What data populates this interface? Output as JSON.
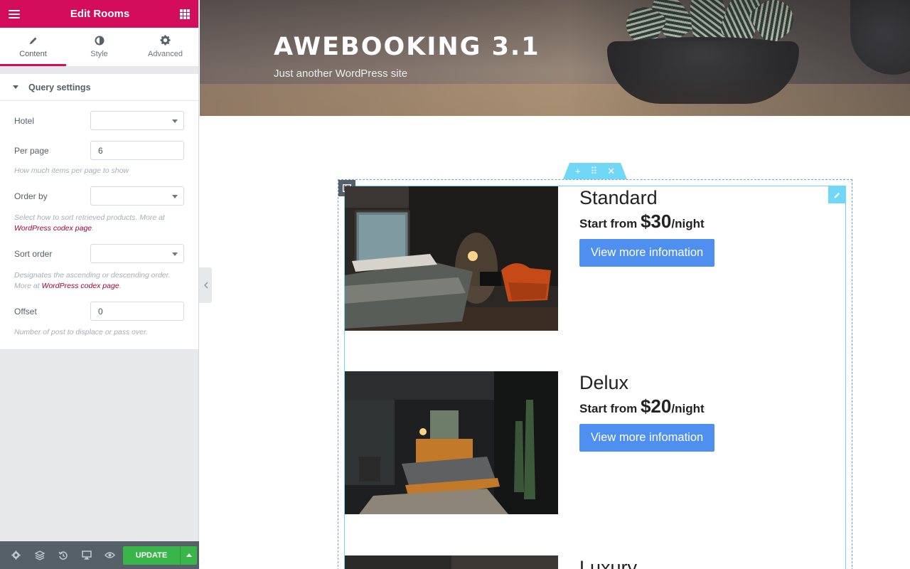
{
  "panel": {
    "title": "Edit Rooms",
    "tabs": [
      {
        "label": "Content",
        "icon": "pencil-icon"
      },
      {
        "label": "Style",
        "icon": "half-circle-icon"
      },
      {
        "label": "Advanced",
        "icon": "gear-icon"
      }
    ],
    "section_title": "Query settings",
    "controls": {
      "hotel": {
        "label": "Hotel",
        "value": ""
      },
      "per_page": {
        "label": "Per page",
        "value": "6",
        "desc": "How much items per page to show"
      },
      "order_by": {
        "label": "Order by",
        "value": "",
        "desc_text": "Select how to sort retrieved products. More at ",
        "desc_link": "WordPress codex page",
        "desc_end": "."
      },
      "sort_order": {
        "label": "Sort order",
        "value": "",
        "desc_text": "Designates the ascending or descending order. More at ",
        "desc_link": "WordPress codex page",
        "desc_end": "."
      },
      "offset": {
        "label": "Offset",
        "value": "0",
        "desc": "Number of post to displace or pass over."
      }
    },
    "footer": {
      "update_label": "UPDATE",
      "icons": [
        "gear-icon",
        "layers-icon",
        "history-icon",
        "desktop-icon",
        "eye-icon"
      ]
    }
  },
  "site": {
    "title": "AWEBOOKING 3.1",
    "tagline": "Just another WordPress site"
  },
  "widget": {
    "handle_icons": {
      "add": "+",
      "move": "⠿",
      "close": "✕"
    }
  },
  "rooms": [
    {
      "name": "Standard",
      "price_prefix": "Start from ",
      "price": "$30",
      "price_suffix": "/night",
      "button": "View more infomation"
    },
    {
      "name": "Delux",
      "price_prefix": "Start from ",
      "price": "$20",
      "price_suffix": "/night",
      "button": "View more infomation"
    },
    {
      "name": "Luxury"
    }
  ],
  "colors": {
    "brand": "#d30c5c",
    "footer": "#556068",
    "update": "#39b54a",
    "editor_accent": "#71d7f7",
    "button": "#4e8ff0"
  }
}
